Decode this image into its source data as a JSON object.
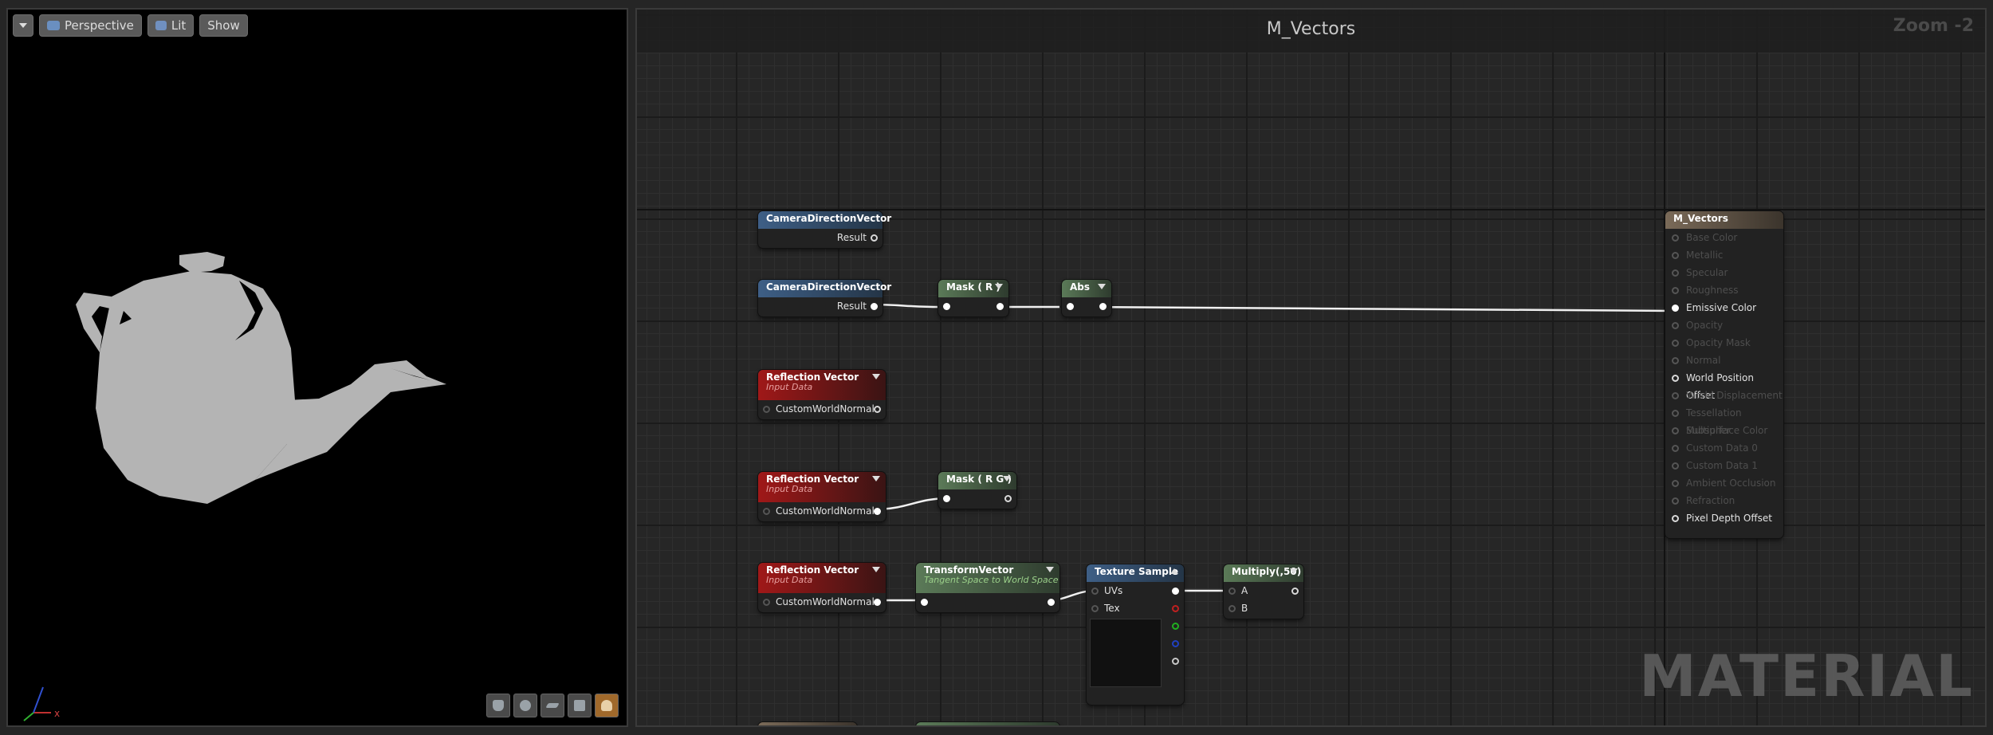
{
  "viewport": {
    "menu_label": "",
    "perspective_label": "Perspective",
    "lit_label": "Lit",
    "show_label": "Show",
    "axis_x": "x"
  },
  "graph": {
    "title": "M_Vectors",
    "zoom": "Zoom -2",
    "watermark": "MATERIAL"
  },
  "nodes": {
    "cam1": {
      "title": "CameraDirectionVector",
      "out": "Result"
    },
    "cam2": {
      "title": "CameraDirectionVector",
      "out": "Result"
    },
    "mask_r": {
      "title": "Mask ( R )"
    },
    "abs": {
      "title": "Abs"
    },
    "refl1": {
      "title": "Reflection Vector",
      "sub": "Input Data",
      "in": "CustomWorldNormal"
    },
    "refl2": {
      "title": "Reflection Vector",
      "sub": "Input Data",
      "in": "CustomWorldNormal"
    },
    "mask_rg": {
      "title": "Mask ( R G )"
    },
    "refl3": {
      "title": "Reflection Vector",
      "sub": "Input Data",
      "in": "CustomWorldNormal"
    },
    "transform": {
      "title": "TransformVector",
      "sub": "Tangent Space to World Space"
    },
    "texture": {
      "title": "Texture Sample",
      "uvs": "UVs",
      "tex": "Tex"
    },
    "multiply": {
      "title": "Multiply(,50)",
      "a": "A",
      "b": "B"
    },
    "material": {
      "title": "M_Vectors",
      "inputs": [
        "Base Color",
        "Metallic",
        "Specular",
        "Roughness",
        "Emissive Color",
        "Opacity",
        "Opacity Mask",
        "Normal",
        "World Position Offset",
        "World Displacement",
        "Tessellation Multiplier",
        "Subsurface Color",
        "Custom Data 0",
        "Custom Data 1",
        "Ambient Occlusion",
        "Refraction",
        "Pixel Depth Offset"
      ],
      "active": [
        4,
        8,
        16
      ]
    }
  },
  "colors": {
    "accent": "#a0692b",
    "emissive_wire": "#ffffff"
  }
}
